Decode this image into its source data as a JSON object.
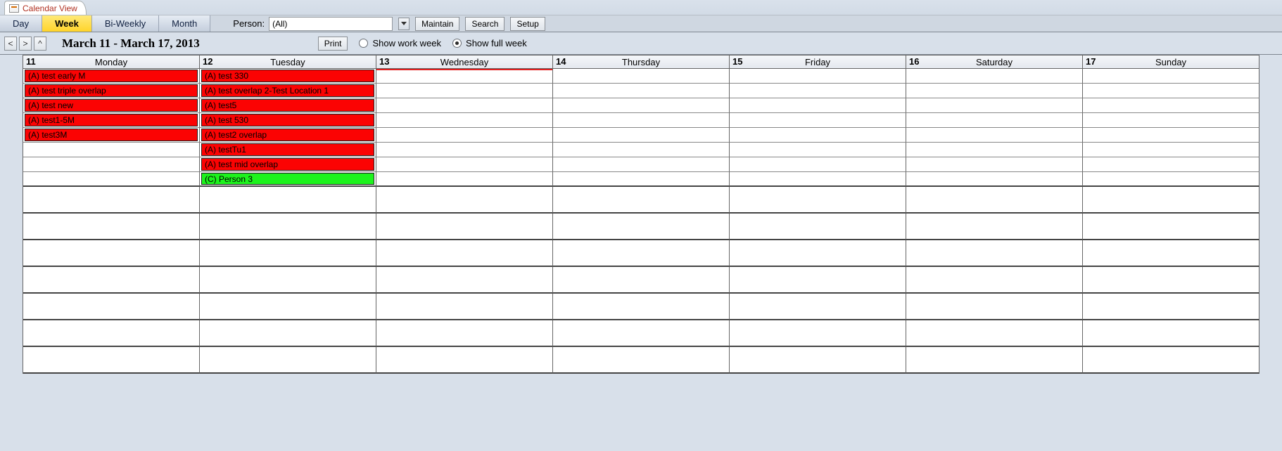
{
  "tab": {
    "title": "Calendar View"
  },
  "viewTabs": {
    "day": "Day",
    "week": "Week",
    "biweekly": "Bi-Weekly",
    "month": "Month",
    "active": "Week"
  },
  "person": {
    "label": "Person:",
    "value": "(All)"
  },
  "toolbarButtons": {
    "maintain": "Maintain",
    "search": "Search",
    "setup": "Setup"
  },
  "nav": {
    "prev": "<",
    "next": ">",
    "up": "^"
  },
  "dateRange": "March 11 - March 17, 2013",
  "printLabel": "Print",
  "radios": {
    "workWeek": "Show work week",
    "fullWeek": "Show full week",
    "selected": "fullWeek"
  },
  "days": [
    {
      "num": "11",
      "name": "Monday"
    },
    {
      "num": "12",
      "name": "Tuesday"
    },
    {
      "num": "13",
      "name": "Wednesday"
    },
    {
      "num": "14",
      "name": "Thursday"
    },
    {
      "num": "15",
      "name": "Friday"
    },
    {
      "num": "16",
      "name": "Saturday"
    },
    {
      "num": "17",
      "name": "Sunday"
    }
  ],
  "todayIndex": 2,
  "grid": {
    "topRows": 8,
    "bottomRows": 7
  },
  "events": {
    "0": [
      {
        "text": "(A) test early M",
        "color": "red"
      },
      {
        "text": "(A) test triple overlap",
        "color": "red"
      },
      {
        "text": "(A) test new",
        "color": "red"
      },
      {
        "text": "(A) test1-5M",
        "color": "red"
      },
      {
        "text": "(A) test3M",
        "color": "red"
      }
    ],
    "1": [
      {
        "text": "(A) test 330",
        "color": "red"
      },
      {
        "text": "(A) test overlap 2-Test Location 1",
        "color": "red"
      },
      {
        "text": "(A) test5",
        "color": "red"
      },
      {
        "text": "(A) test 530",
        "color": "red"
      },
      {
        "text": "(A) test2 overlap",
        "color": "red"
      },
      {
        "text": "(A) testTu1",
        "color": "red"
      },
      {
        "text": "(A) test mid overlap",
        "color": "red"
      },
      {
        "text": "(C) Person 3",
        "color": "green"
      }
    ]
  }
}
